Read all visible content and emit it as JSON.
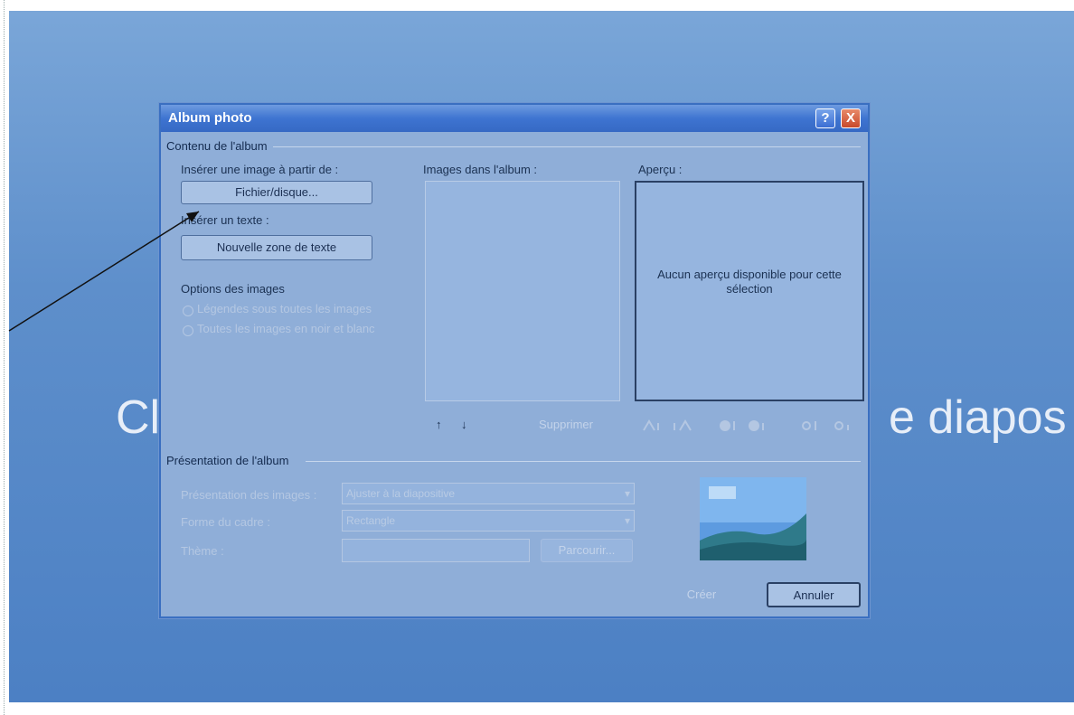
{
  "slide": {
    "title_left": "Cl",
    "title_right": "e diapos"
  },
  "dialog": {
    "title": "Album photo",
    "help_label": "?",
    "close_label": "X",
    "contents_group": "Contenu de l'album",
    "insert_image_label": "Insérer une image à partir de :",
    "file_disk_button": "Fichier/disque...",
    "insert_text_label": "Insérer un texte :",
    "new_textbox_button": "Nouvelle zone de texte",
    "image_options_label": "Options des images",
    "option_captions": "Légendes sous toutes les images",
    "option_bw": "Toutes les images en noir et blanc",
    "images_in_album_label": "Images dans l'album :",
    "preview_label": "Aperçu :",
    "preview_text": "Aucun aperçu disponible pour cette sélection",
    "move_up": "↑",
    "move_down": "↓",
    "remove_button": "Supprimer",
    "presentation_group": "Présentation de l'album",
    "picture_layout_label": "Présentation des images :",
    "picture_layout_value": "Ajuster à la diapositive",
    "frame_shape_label": "Forme du cadre :",
    "frame_shape_value": "Rectangle",
    "theme_label": "Thème :",
    "browse_button": "Parcourir...",
    "create_button": "Créer",
    "cancel_button": "Annuler"
  }
}
